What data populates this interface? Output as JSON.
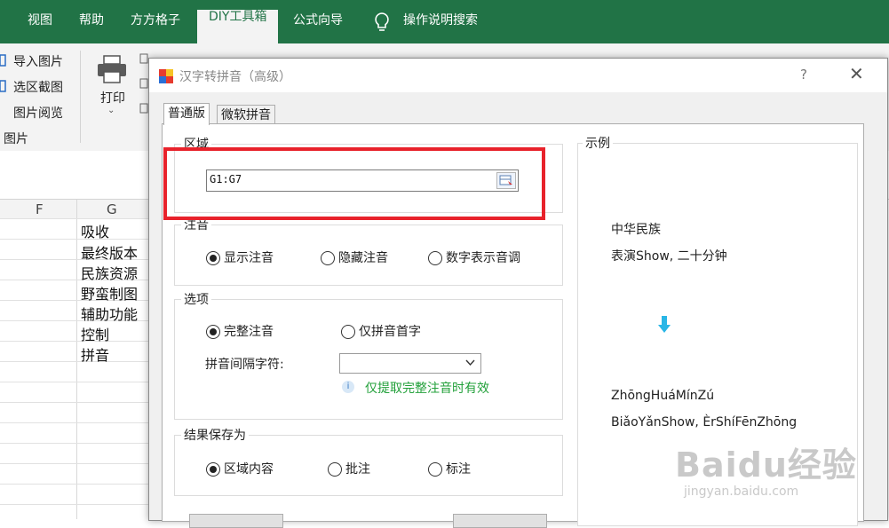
{
  "ribbon": {
    "tabs": [
      "视图",
      "帮助",
      "方方格子",
      "DIY工具箱",
      "公式向导",
      "操作说明搜索"
    ],
    "active_tab": "DIY工具箱",
    "items": {
      "import_image": "导入图片",
      "region_capture": "选区截图",
      "image_browse": "图片阅览",
      "group_images": "图片",
      "print": "打印"
    }
  },
  "sheet": {
    "columns": [
      "F",
      "G"
    ],
    "cells": [
      "吸收",
      "最终版本",
      "民族资源",
      "野蛮制图",
      "辅助功能",
      "控制",
      "拼音"
    ]
  },
  "dialog": {
    "title": "汉字转拼音（高级）",
    "help": "?",
    "close": "✕",
    "tabs": [
      "普通版",
      "微软拼音"
    ],
    "region": {
      "label": "区域",
      "value": "G1:G7"
    },
    "annotation": {
      "label": "注音",
      "options": [
        "显示注音",
        "隐藏注音",
        "数字表示音调"
      ],
      "selected": "显示注音"
    },
    "options": {
      "label": "选项",
      "modes": [
        "完整注音",
        "仅拼音首字"
      ],
      "selected": "完整注音",
      "separator_label": "拼音间隔字符:",
      "separator_value": "",
      "info": "仅提取完整注音时有效"
    },
    "save": {
      "label": "结果保存为",
      "options": [
        "区域内容",
        "批注",
        "标注"
      ],
      "selected": "区域内容"
    },
    "example": {
      "label": "示例",
      "input_lines": [
        "中华民族",
        "表演Show, 二十分钟"
      ],
      "output_lines": [
        "ZhōngHuáMínZú",
        "BiǎoYǎnShow, ÈrShíFēnZhōng"
      ]
    }
  },
  "watermark": {
    "brand": "Baidu经验",
    "url": "jingyan.baidu.com"
  },
  "colors": {
    "excel_green": "#217346",
    "highlight": "#e8222b",
    "info_green": "#22a03a",
    "arrow": "#29b6e6"
  }
}
